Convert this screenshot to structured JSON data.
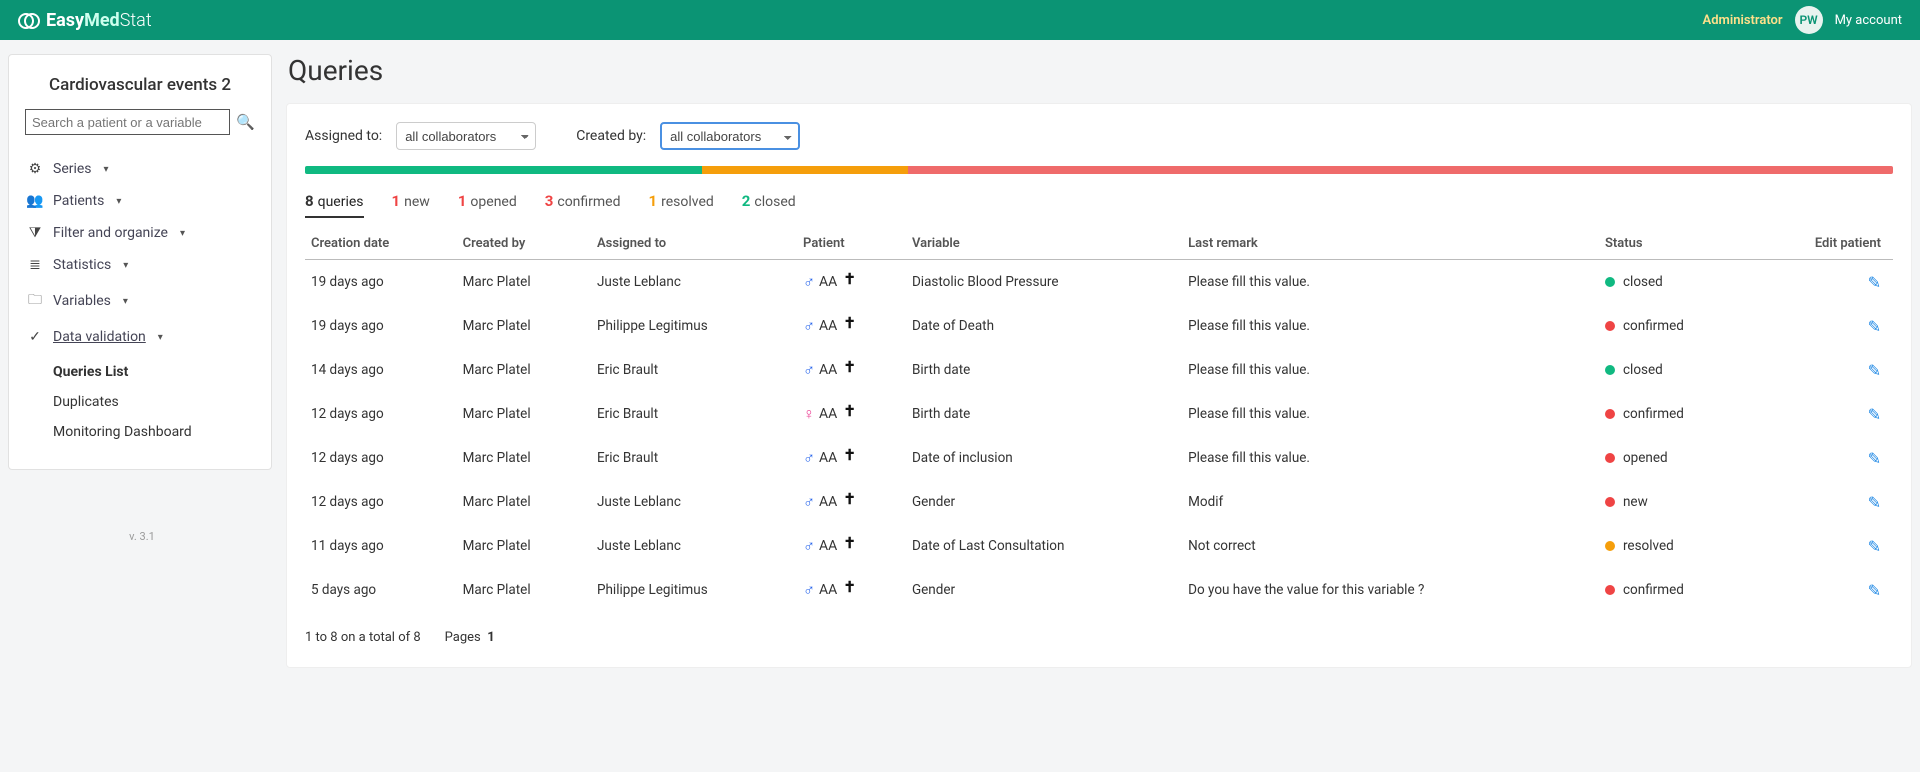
{
  "header": {
    "brand_prefix": "Easy",
    "brand_mid": "Med",
    "brand_suffix": "Stat",
    "admin_label": "Administrator",
    "avatar_initials": "PW",
    "my_account": "My account"
  },
  "sidebar": {
    "title": "Cardiovascular events 2",
    "search_placeholder": "Search a patient or a variable",
    "items": [
      {
        "icon": "⚙",
        "label": "Series"
      },
      {
        "icon": "👥",
        "label": "Patients"
      },
      {
        "icon": "▼",
        "label": "Filter and organize",
        "filter": true
      },
      {
        "icon": "≣",
        "label": "Statistics"
      },
      {
        "icon": "🗀",
        "label": "Variables"
      },
      {
        "icon": "✓",
        "label": "Data validation",
        "active": true
      }
    ],
    "sub_items": [
      {
        "label": "Queries List",
        "selected": true
      },
      {
        "label": "Duplicates"
      },
      {
        "label": "Monitoring Dashboard"
      }
    ]
  },
  "version": "v. 3.1",
  "page": {
    "title": "Queries",
    "filter_assigned_label": "Assigned to:",
    "filter_created_label": "Created by:",
    "collaborator_option": "all collaborators"
  },
  "status_bar": [
    {
      "color": "#10b981",
      "pct": 25
    },
    {
      "color": "#f59e0b",
      "pct": 13
    },
    {
      "color": "#ef6b6b",
      "pct": 62
    }
  ],
  "summary": [
    {
      "count": 8,
      "label": "queries",
      "color": "dark",
      "active": true
    },
    {
      "count": 1,
      "label": "new",
      "color": "red"
    },
    {
      "count": 1,
      "label": "opened",
      "color": "red"
    },
    {
      "count": 3,
      "label": "confirmed",
      "color": "red"
    },
    {
      "count": 1,
      "label": "resolved",
      "color": "orange"
    },
    {
      "count": 2,
      "label": "closed",
      "color": "green"
    }
  ],
  "columns": {
    "creation": "Creation date",
    "created_by": "Created by",
    "assigned_to": "Assigned to",
    "patient": "Patient",
    "variable": "Variable",
    "remark": "Last remark",
    "status": "Status",
    "edit": "Edit patient"
  },
  "rows": [
    {
      "creation": "19 days ago",
      "created_by": "Marc Platel",
      "assigned_to": "Juste Leblanc",
      "patient_gender": "m",
      "patient_code": "AA",
      "deceased": true,
      "variable": "Diastolic Blood Pressure",
      "remark": "Please fill this value.",
      "status": "closed",
      "status_dot": "green"
    },
    {
      "creation": "19 days ago",
      "created_by": "Marc Platel",
      "assigned_to": "Philippe Legitimus",
      "patient_gender": "m",
      "patient_code": "AA",
      "deceased": true,
      "variable": "Date of Death",
      "remark": "Please fill this value.",
      "status": "confirmed",
      "status_dot": "red"
    },
    {
      "creation": "14 days ago",
      "created_by": "Marc Platel",
      "assigned_to": "Eric Brault",
      "patient_gender": "m",
      "patient_code": "AA",
      "deceased": true,
      "variable": "Birth date",
      "remark": "Please fill this value.",
      "status": "closed",
      "status_dot": "green"
    },
    {
      "creation": "12 days ago",
      "created_by": "Marc Platel",
      "assigned_to": "Eric Brault",
      "patient_gender": "f",
      "patient_code": "AA",
      "deceased": true,
      "variable": "Birth date",
      "remark": "Please fill this value.",
      "status": "confirmed",
      "status_dot": "red"
    },
    {
      "creation": "12 days ago",
      "created_by": "Marc Platel",
      "assigned_to": "Eric Brault",
      "patient_gender": "m",
      "patient_code": "AA",
      "deceased": true,
      "variable": "Date of inclusion",
      "remark": "Please fill this value.",
      "status": "opened",
      "status_dot": "red"
    },
    {
      "creation": "12 days ago",
      "created_by": "Marc Platel",
      "assigned_to": "Juste Leblanc",
      "patient_gender": "m",
      "patient_code": "AA",
      "deceased": true,
      "variable": "Gender",
      "remark": "Modif",
      "status": "new",
      "status_dot": "red"
    },
    {
      "creation": "11 days ago",
      "created_by": "Marc Platel",
      "assigned_to": "Juste Leblanc",
      "patient_gender": "m",
      "patient_code": "AA",
      "deceased": true,
      "variable": "Date of Last Consultation",
      "remark": "Not correct",
      "status": "resolved",
      "status_dot": "orange"
    },
    {
      "creation": "5 days ago",
      "created_by": "Marc Platel",
      "assigned_to": "Philippe Legitimus",
      "patient_gender": "m",
      "patient_code": "AA",
      "deceased": true,
      "variable": "Gender",
      "remark": "Do you have the value for this variable ?",
      "status": "confirmed",
      "status_dot": "red"
    }
  ],
  "pager": {
    "range_text": "1 to 8 on a total of 8",
    "pages_label": "Pages",
    "current_page": "1"
  }
}
